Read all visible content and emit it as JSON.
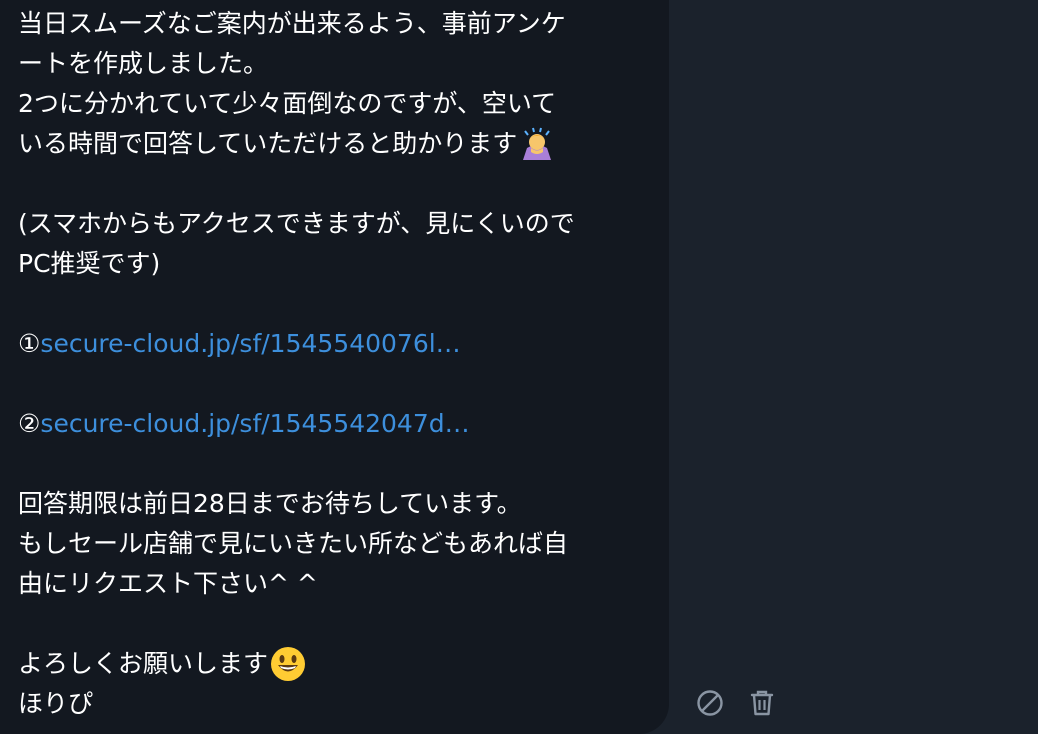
{
  "message": {
    "lines": [
      "当日スムーズなご案内が出来るよう、事前アンケ",
      "ートを作成しました。",
      "2つに分かれていて少々面倒なのですが、空いて",
      "いる時間で回答していただけると助かります",
      "(スマホからもアクセスできますが、見にくいので",
      "PC推奨です)",
      "回答期限は前日28日までお待ちしています。",
      "もしセール店舗で見にいきたい所などもあれば自",
      "由にリクエスト下さい^ ^",
      "よろしくお願いします",
      "ほりぴ"
    ],
    "links": [
      {
        "marker": "①",
        "text": "secure-cloud.jp/sf/1545540076l…"
      },
      {
        "marker": "②",
        "text": "secure-cloud.jp/sf/1545542047d…"
      }
    ],
    "emojis": {
      "bow": "person-bowing-emoji",
      "smile": "smiling-face-emoji"
    }
  },
  "actions": {
    "disable_icon": "disable-icon",
    "delete_icon": "trash-icon"
  },
  "colors": {
    "background": "#1b222c",
    "bubble": "#131820",
    "text": "#ffffff",
    "link": "#3d8fdc",
    "icon": "#8a95a3"
  }
}
